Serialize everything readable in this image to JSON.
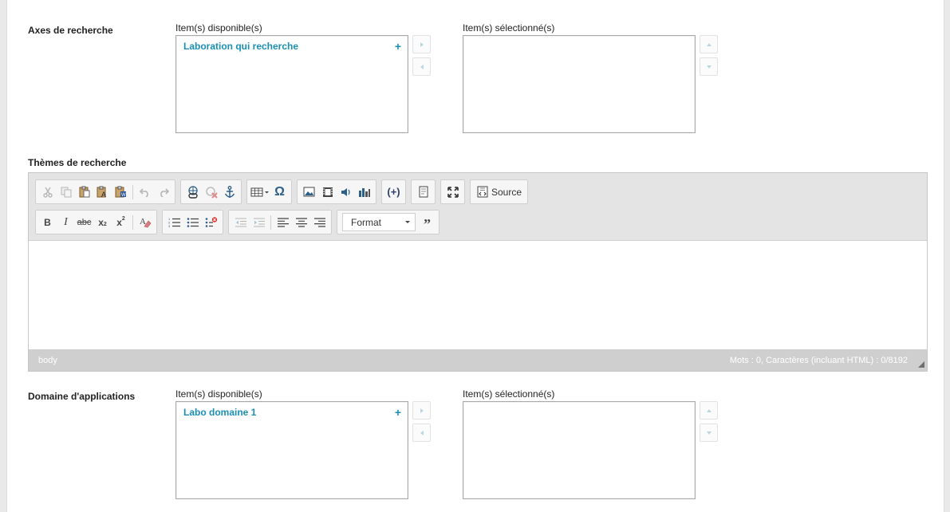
{
  "axes": {
    "label": "Axes de recherche",
    "available_label": "Item(s) disponible(s)",
    "selected_label": "Item(s) sélectionné(s)",
    "available_items": [
      "Laboration qui recherche"
    ]
  },
  "themes": {
    "label": "Thèmes de recherche",
    "editor": {
      "source_label": "Source",
      "format_label": "Format",
      "path": "body",
      "wordcount": "Mots : 0, Caractères (incluant HTML) : 0/8192"
    }
  },
  "domaine": {
    "label": "Domaine d'applications",
    "available_label": "Item(s) disponible(s)",
    "selected_label": "Item(s) sélectionné(s)",
    "available_items": [
      "Labo domaine 1"
    ]
  },
  "colors": {
    "accent": "#1a8fb5",
    "status_bar": "#cfcfcf",
    "toolbar_bg": "#e4e4e4"
  }
}
